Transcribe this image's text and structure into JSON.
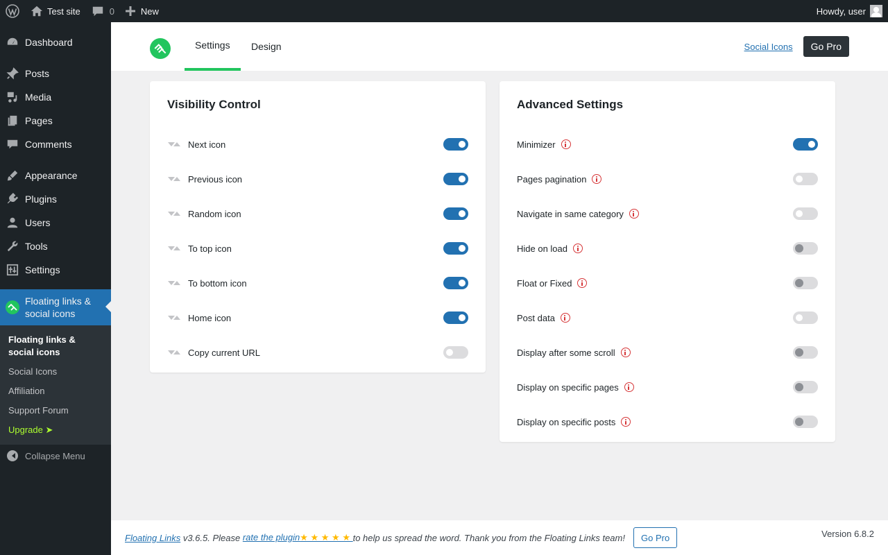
{
  "adminbar": {
    "site_name": "Test site",
    "comments_count": "0",
    "new_label": "New",
    "howdy": "Howdy, user"
  },
  "sidebar": {
    "items": [
      {
        "label": "Dashboard",
        "icon": "dashboard-icon"
      },
      {
        "label": "Posts",
        "icon": "pin-icon"
      },
      {
        "label": "Media",
        "icon": "media-icon"
      },
      {
        "label": "Pages",
        "icon": "pages-icon"
      },
      {
        "label": "Comments",
        "icon": "comment-icon"
      },
      {
        "label": "Appearance",
        "icon": "brush-icon"
      },
      {
        "label": "Plugins",
        "icon": "plug-icon"
      },
      {
        "label": "Users",
        "icon": "user-icon"
      },
      {
        "label": "Tools",
        "icon": "wrench-icon"
      },
      {
        "label": "Settings",
        "icon": "sliders-icon"
      },
      {
        "label": "Floating links & social icons",
        "icon": "floating-links-icon"
      }
    ],
    "submenu": [
      "Floating links & social icons",
      "Social Icons",
      "Affiliation",
      "Support Forum",
      "Upgrade ➤"
    ],
    "collapse": "Collapse Menu"
  },
  "header": {
    "tabs": [
      "Settings",
      "Design"
    ],
    "social_link": "Social Icons",
    "gopro": "Go Pro"
  },
  "visibility": {
    "title": "Visibility Control",
    "rows": [
      {
        "label": "Next icon",
        "state": "on"
      },
      {
        "label": "Previous icon",
        "state": "on"
      },
      {
        "label": "Random icon",
        "state": "on"
      },
      {
        "label": "To top icon",
        "state": "on"
      },
      {
        "label": "To bottom icon",
        "state": "on"
      },
      {
        "label": "Home icon",
        "state": "on"
      },
      {
        "label": "Copy current URL",
        "state": "off"
      }
    ]
  },
  "advanced": {
    "title": "Advanced Settings",
    "rows": [
      {
        "label": "Minimizer",
        "state": "on"
      },
      {
        "label": "Pages pagination",
        "state": "off"
      },
      {
        "label": "Navigate in same category",
        "state": "off"
      },
      {
        "label": "Hide on load",
        "state": "disabled"
      },
      {
        "label": "Float or Fixed",
        "state": "disabled"
      },
      {
        "label": "Post data",
        "state": "off"
      },
      {
        "label": "Display after some scroll",
        "state": "disabled"
      },
      {
        "label": "Display on specific pages",
        "state": "disabled"
      },
      {
        "label": "Display on specific posts",
        "state": "disabled"
      }
    ]
  },
  "footer": {
    "plugin_link": "Floating Links",
    "text_1": " v3.6.5. Please ",
    "rate_link": "rate the plugin",
    "stars": "★ ★ ★ ★ ★ ",
    "text_2": "to help us spread the word. Thank you from the Floating Links team!",
    "gopro": "Go Pro",
    "version": "Version 6.8.2"
  },
  "colors": {
    "primary": "#2271b1",
    "accent": "#22c55e",
    "admin_dark": "#1d2327"
  }
}
